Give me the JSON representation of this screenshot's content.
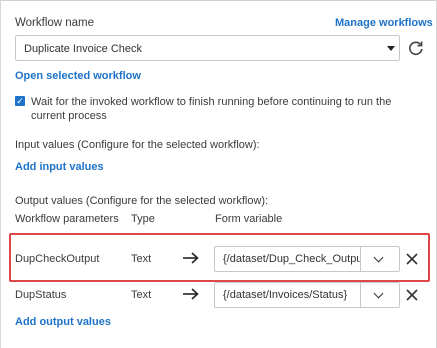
{
  "workflow": {
    "label": "Workflow name",
    "manage_link": "Manage workflows",
    "selected": "Duplicate Invoice Check",
    "open_link": "Open selected workflow"
  },
  "wait_option": {
    "checked": true,
    "line1": "Wait for the invoked workflow to finish running before continuing to run the",
    "line2": "current process"
  },
  "input_values": {
    "heading": "Input values (Configure for the selected workflow):",
    "add_link": "Add input values"
  },
  "output_values": {
    "heading": "Output values (Configure for the selected workflow):",
    "columns": [
      "Workflow parameters",
      "Type",
      "Form variable"
    ],
    "rows": [
      {
        "parameter": "DupCheckOutput",
        "type": "Text",
        "form_variable": "{/dataset/Dup_Check_Output}",
        "highlighted": true
      },
      {
        "parameter": "DupStatus",
        "type": "Text",
        "form_variable": "{/dataset/Invoices/Status}",
        "highlighted": false
      }
    ],
    "add_link": "Add output values"
  },
  "colors": {
    "link": "#1e73c8",
    "highlight": "#e04646",
    "border": "#c8c8c8"
  },
  "icons": {
    "refresh": "refresh-icon",
    "arrow": "arrow-right-icon",
    "remove": "close-icon",
    "dropdown": "chevron-down-icon"
  }
}
